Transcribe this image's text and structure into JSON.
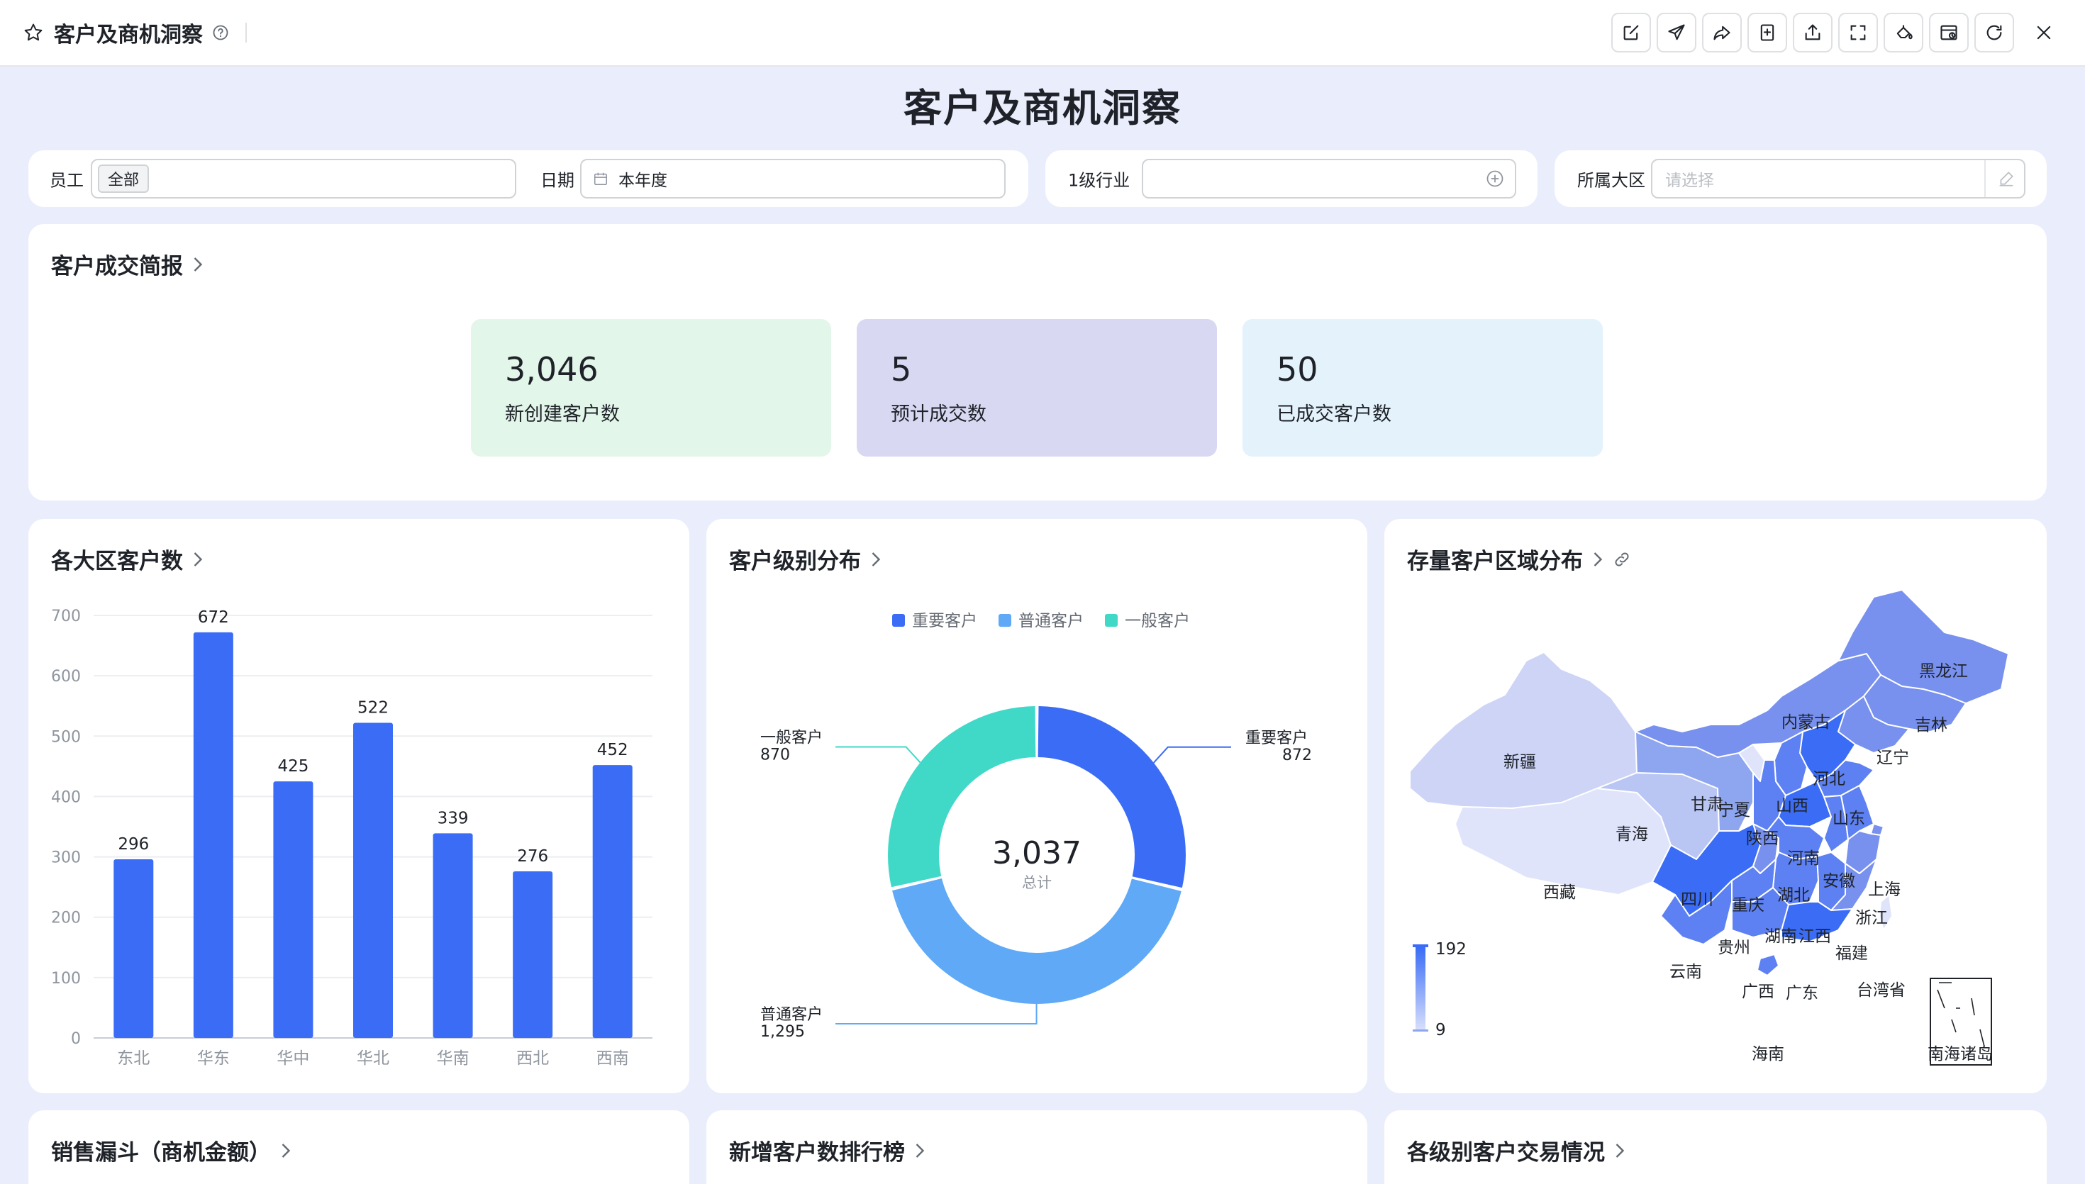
{
  "window": {
    "title": "客户及商机洞察",
    "toolbar_icons": [
      "edit-icon",
      "send-icon",
      "share-icon",
      "bookmark-add-icon",
      "export-icon",
      "fullscreen-icon",
      "paint-icon",
      "schedule-icon",
      "refresh-icon"
    ]
  },
  "page": {
    "title": "客户及商机洞察"
  },
  "filters": {
    "employee": {
      "label": "员工",
      "value": "全部"
    },
    "date": {
      "label": "日期",
      "value": "本年度"
    },
    "industry": {
      "label": "1级行业",
      "value": ""
    },
    "region": {
      "label": "所属大区",
      "placeholder": "请选择"
    }
  },
  "summary": {
    "title": "客户成交简报",
    "kpis": [
      {
        "value": "3,046",
        "label": "新创建客户数",
        "color": "#e3f6ea"
      },
      {
        "value": "5",
        "label": "预计成交数",
        "color": "#d9d8f3"
      },
      {
        "value": "50",
        "label": "已成交客户数",
        "color": "#e4f2fb"
      }
    ]
  },
  "colors": {
    "accent": "#3a6cf6",
    "sky": "#5fa9f6",
    "teal": "#40d9c8"
  },
  "charts": {
    "region_bar": {
      "title": "各大区客户数",
      "chart_data": {
        "type": "bar",
        "categories": [
          "东北",
          "华东",
          "华中",
          "华北",
          "华南",
          "西北",
          "西南"
        ],
        "values": [
          296,
          672,
          425,
          522,
          339,
          276,
          452
        ],
        "ylim": [
          0,
          700
        ],
        "yticks": [
          0,
          100,
          200,
          300,
          400,
          500,
          600,
          700
        ],
        "grid": true,
        "color": "#3a6cf6"
      }
    },
    "level_donut": {
      "title": "客户级别分布",
      "chart_data": {
        "type": "pie",
        "categories": [
          "重要客户",
          "普通客户",
          "一般客户"
        ],
        "values": [
          872,
          1295,
          870
        ],
        "labels": [
          "872",
          "1,295",
          "870"
        ],
        "colors": [
          "#3a6cf6",
          "#5fa9f6",
          "#40d9c8"
        ],
        "total": "3,037",
        "total_label": "总计",
        "legend": "top"
      }
    },
    "region_map": {
      "title": "存量客户区域分布",
      "legend_max": "192",
      "legend_min": "9",
      "provinces": [
        "黑龙江",
        "吉林",
        "辽宁",
        "内蒙古",
        "新疆",
        "河北",
        "山西",
        "山东",
        "甘肃",
        "宁夏",
        "陕西",
        "青海",
        "河南",
        "西藏",
        "四川",
        "湖北",
        "安徽",
        "上海",
        "重庆",
        "浙江",
        "湖南",
        "江西",
        "贵州",
        "福建",
        "云南",
        "广西",
        "广东",
        "台湾省",
        "海南",
        "南海诸岛"
      ]
    }
  },
  "bottom_cards": [
    {
      "title": "销售漏斗（商机金额）"
    },
    {
      "title": "新增客户数排行榜"
    },
    {
      "title": "各级别客户交易情况"
    }
  ]
}
